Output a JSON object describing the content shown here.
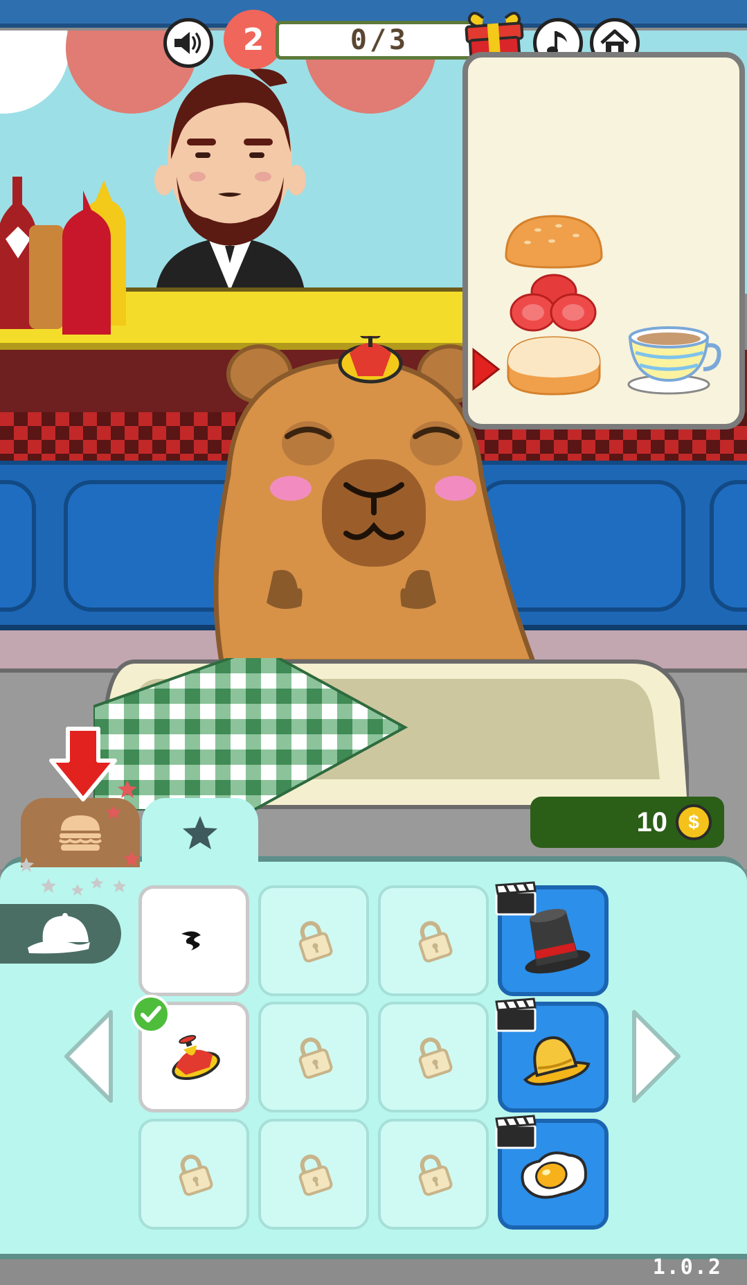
{
  "hud": {
    "level": "2",
    "progress": "0/3",
    "sound_icon": "speaker-icon",
    "music_icon": "music-note-icon",
    "home_icon": "home-icon",
    "gift_icon": "gift-icon"
  },
  "order": {
    "items": [
      "bun-top",
      "tomato",
      "bun-bottom",
      "tea-cup"
    ],
    "current_indicator": "arrow-right-icon"
  },
  "wallet": {
    "coins": "10",
    "currency_symbol": "$"
  },
  "tabs": {
    "food_icon": "burger-icon",
    "favorites_icon": "star-icon",
    "active": "favorites"
  },
  "category": {
    "current": "hats",
    "icon": "cap-icon"
  },
  "grid": {
    "slots": [
      {
        "row": 1,
        "col": 1,
        "state": "owned",
        "item": "mustache"
      },
      {
        "row": 1,
        "col": 2,
        "state": "locked"
      },
      {
        "row": 1,
        "col": 3,
        "state": "locked"
      },
      {
        "row": 1,
        "col": 4,
        "state": "video-unlock",
        "item": "top-hat"
      },
      {
        "row": 2,
        "col": 1,
        "state": "equipped",
        "item": "propeller-cap"
      },
      {
        "row": 2,
        "col": 2,
        "state": "locked"
      },
      {
        "row": 2,
        "col": 3,
        "state": "locked"
      },
      {
        "row": 2,
        "col": 4,
        "state": "video-unlock",
        "item": "bucket-hat"
      },
      {
        "row": 3,
        "col": 1,
        "state": "locked"
      },
      {
        "row": 3,
        "col": 2,
        "state": "locked"
      },
      {
        "row": 3,
        "col": 3,
        "state": "locked"
      },
      {
        "row": 3,
        "col": 4,
        "state": "video-unlock",
        "item": "fried-egg"
      }
    ]
  },
  "version": "1.0.2",
  "colors": {
    "panel": "#b8f6ee",
    "level_badge": "#f0665a",
    "coin_bar": "#2b5e17",
    "premium_slot": "#2c8fea"
  }
}
